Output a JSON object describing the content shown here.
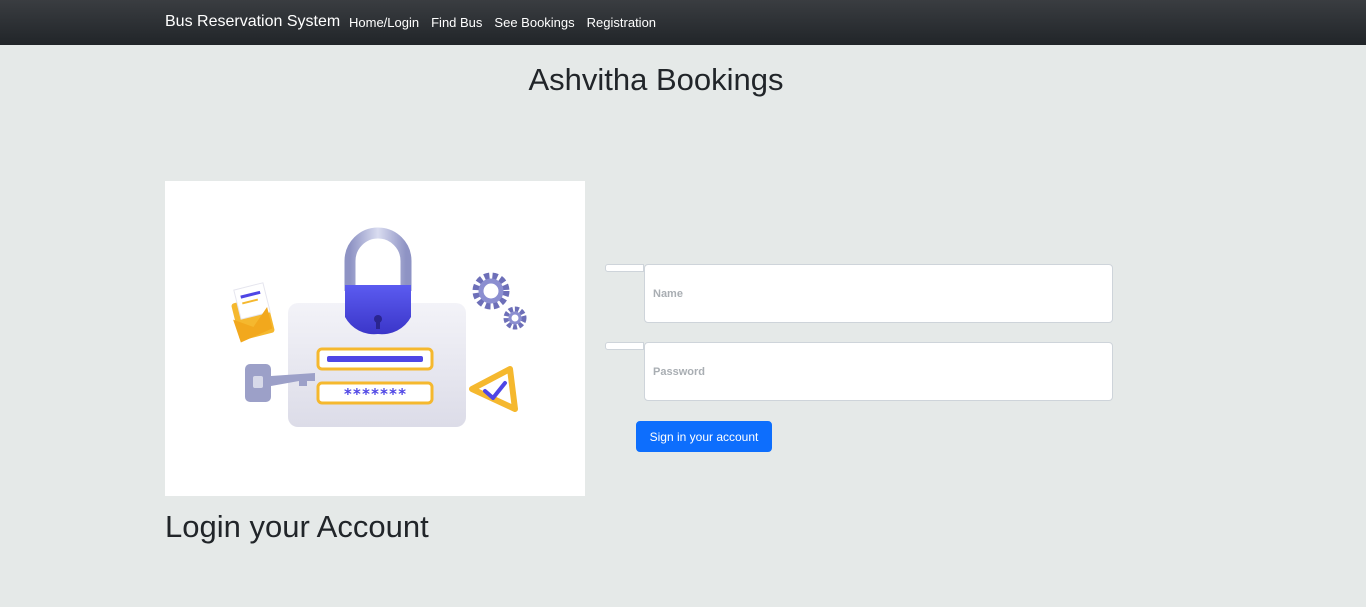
{
  "navbar": {
    "brand": "Bus Reservation System",
    "links": [
      {
        "label": "Home/Login"
      },
      {
        "label": "Find Bus"
      },
      {
        "label": "See Bookings"
      },
      {
        "label": "Registration"
      }
    ]
  },
  "page": {
    "title": "Ashvitha Bookings",
    "login_heading": "Login your Account"
  },
  "illustration": {
    "icons": [
      "padlock-icon",
      "password-card-icon",
      "key-icon",
      "envelope-icon",
      "gear-icon",
      "check-warning-icon"
    ],
    "password_mask": "*******"
  },
  "form": {
    "name": {
      "value": "",
      "placeholder": "Name"
    },
    "password": {
      "value": "",
      "placeholder": "Password"
    },
    "submit_label": "Sign in your account"
  },
  "colors": {
    "navbar_bg": "#212529",
    "page_bg": "#e5e9e8",
    "primary": "#0d6efd",
    "illustration_accent": "#4f46e5",
    "illustration_gold": "#f5b82e"
  }
}
